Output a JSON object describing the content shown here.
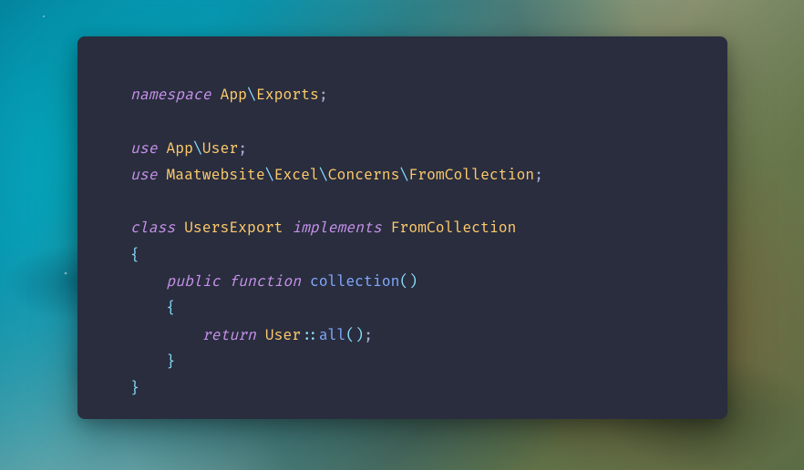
{
  "code": {
    "lines": [
      {
        "tokens": [
          {
            "cls": "tok-kw",
            "t": "namespace "
          },
          {
            "cls": "tok-ns",
            "t": "App"
          },
          {
            "cls": "tok-sep",
            "t": "\\"
          },
          {
            "cls": "tok-ns",
            "t": "Exports"
          },
          {
            "cls": "tok-punc",
            "t": ";"
          }
        ]
      },
      {
        "tokens": []
      },
      {
        "tokens": [
          {
            "cls": "tok-kw",
            "t": "use "
          },
          {
            "cls": "tok-ns",
            "t": "App"
          },
          {
            "cls": "tok-sep",
            "t": "\\"
          },
          {
            "cls": "tok-ns",
            "t": "User"
          },
          {
            "cls": "tok-punc",
            "t": ";"
          }
        ]
      },
      {
        "tokens": [
          {
            "cls": "tok-kw",
            "t": "use "
          },
          {
            "cls": "tok-ns",
            "t": "Maatwebsite"
          },
          {
            "cls": "tok-sep",
            "t": "\\"
          },
          {
            "cls": "tok-ns",
            "t": "Excel"
          },
          {
            "cls": "tok-sep",
            "t": "\\"
          },
          {
            "cls": "tok-ns",
            "t": "Concerns"
          },
          {
            "cls": "tok-sep",
            "t": "\\"
          },
          {
            "cls": "tok-ns",
            "t": "FromCollection"
          },
          {
            "cls": "tok-punc",
            "t": ";"
          }
        ]
      },
      {
        "tokens": []
      },
      {
        "tokens": [
          {
            "cls": "tok-kw",
            "t": "class "
          },
          {
            "cls": "tok-ns",
            "t": "UsersExport "
          },
          {
            "cls": "tok-kw",
            "t": "implements "
          },
          {
            "cls": "tok-ns",
            "t": "FromCollection"
          }
        ]
      },
      {
        "tokens": [
          {
            "cls": "tok-brace",
            "t": "{"
          }
        ]
      },
      {
        "tokens": [
          {
            "cls": "tok-plain",
            "t": "    "
          },
          {
            "cls": "tok-kw",
            "t": "public "
          },
          {
            "cls": "tok-kw",
            "t": "function "
          },
          {
            "cls": "tok-func",
            "t": "collection"
          },
          {
            "cls": "tok-brace",
            "t": "()"
          }
        ]
      },
      {
        "tokens": [
          {
            "cls": "tok-plain",
            "t": "    "
          },
          {
            "cls": "tok-brace",
            "t": "{"
          }
        ]
      },
      {
        "tokens": [
          {
            "cls": "tok-plain",
            "t": "        "
          },
          {
            "cls": "tok-kw",
            "t": "return "
          },
          {
            "cls": "tok-ns",
            "t": "User"
          },
          {
            "cls": "tok-op",
            "t": "::"
          },
          {
            "cls": "tok-func",
            "t": "all"
          },
          {
            "cls": "tok-brace",
            "t": "()"
          },
          {
            "cls": "tok-punc",
            "t": ";"
          }
        ]
      },
      {
        "tokens": [
          {
            "cls": "tok-plain",
            "t": "    "
          },
          {
            "cls": "tok-brace",
            "t": "}"
          }
        ]
      },
      {
        "tokens": [
          {
            "cls": "tok-brace",
            "t": "}"
          }
        ]
      }
    ]
  }
}
